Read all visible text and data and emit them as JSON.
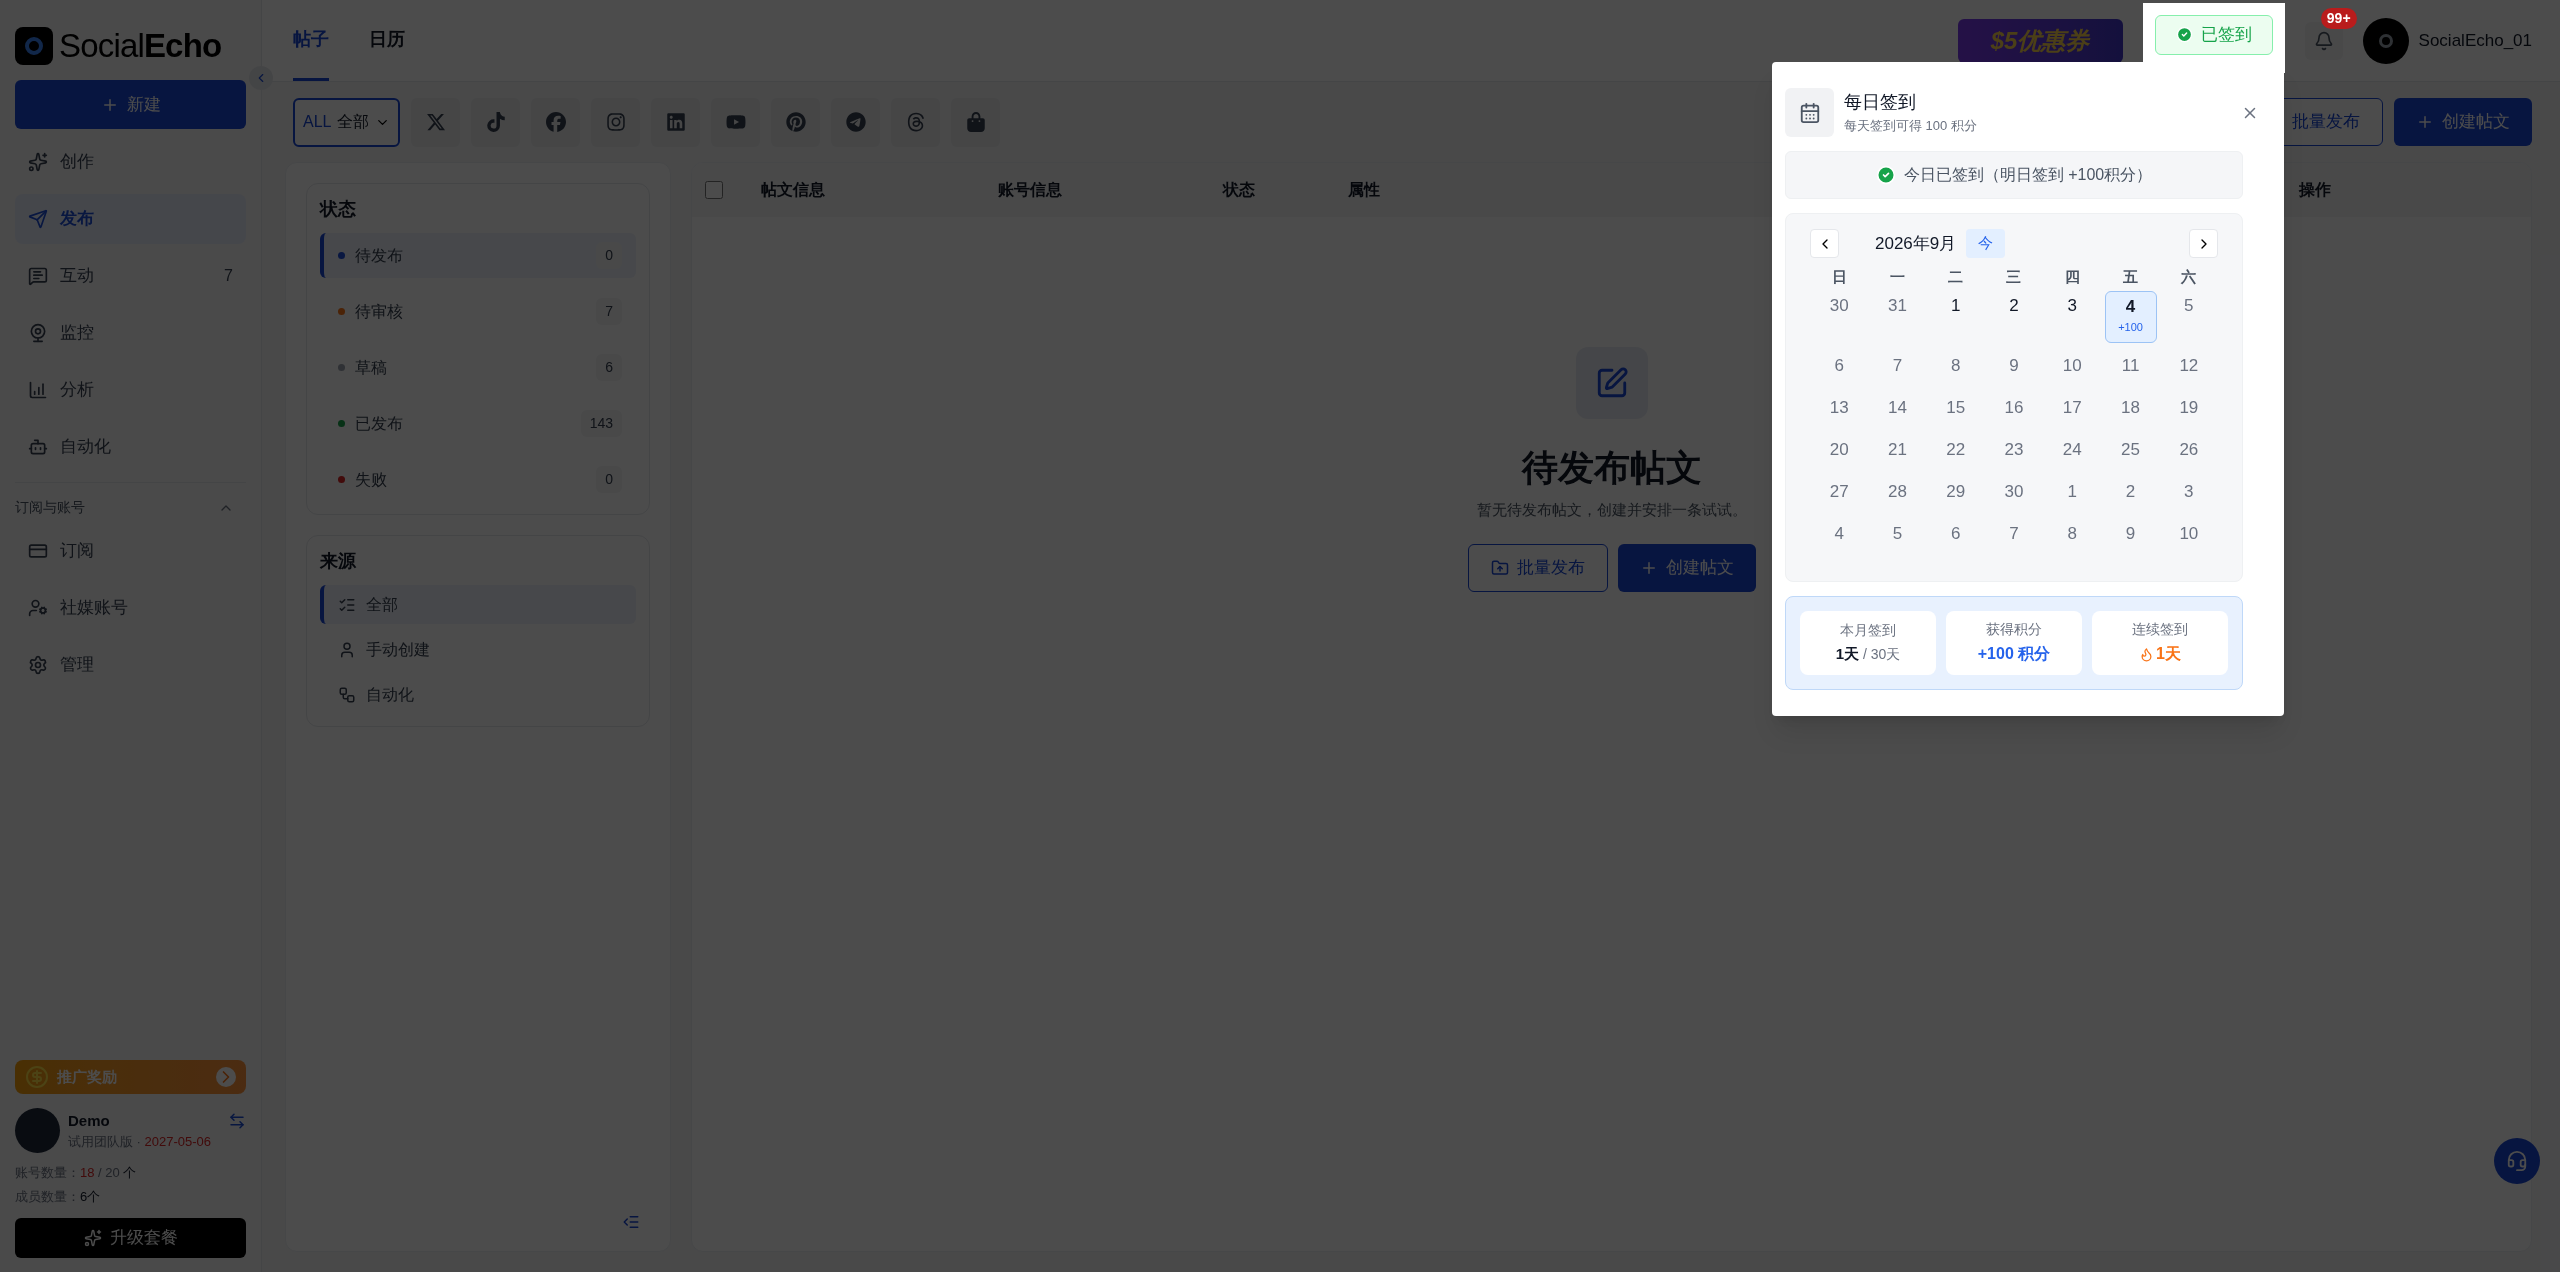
{
  "sidebar": {
    "logo": {
      "plain": "Social",
      "bold": "Echo"
    },
    "new_button": "新建",
    "nav": [
      {
        "label": "创作",
        "selected": false
      },
      {
        "label": "发布",
        "selected": true
      },
      {
        "label": "互动",
        "badge": "7",
        "selected": false
      },
      {
        "label": "监控",
        "selected": false
      },
      {
        "label": "分析",
        "selected": false
      },
      {
        "label": "自动化",
        "selected": false
      }
    ],
    "section": {
      "title": "订阅与账号",
      "expanded": true,
      "items": [
        {
          "label": "订阅",
          "selected": false
        },
        {
          "label": "社媒账号",
          "selected": false
        },
        {
          "label": "管理",
          "selected": false
        }
      ]
    },
    "promo": "推广奖励",
    "user": {
      "name": "Demo",
      "plan": "试用团队版 ·",
      "expiry": "2027-05-06"
    },
    "account_count": {
      "label": "账号数量：",
      "used": "18",
      "rest": "/ 20",
      "unit": "个"
    },
    "member_count": {
      "label": "成员数量：",
      "value": "6个"
    },
    "upgrade_button": "升级套餐"
  },
  "topbar": {
    "tabs": [
      {
        "label": "帖子",
        "selected": true
      },
      {
        "label": "日历",
        "selected": false
      }
    ],
    "coupon": "$5优惠券",
    "checkin_button": "已签到",
    "notification_badge": "99+",
    "username": "SocialEcho_01"
  },
  "filter": {
    "platform_select": {
      "prefix": "ALL",
      "value": "全部"
    }
  },
  "actions": [
    {
      "label": "批量发布",
      "kind": "outline"
    },
    {
      "label": "创建帖文",
      "kind": "primary"
    }
  ],
  "status_filter": {
    "title": "状态",
    "items": [
      {
        "label": "待发布",
        "count": "0",
        "color": "#091741",
        "selected": true
      },
      {
        "label": "待审核",
        "count": "7",
        "color": "#4b2307",
        "selected": false
      },
      {
        "label": "草稿",
        "count": "6",
        "color": "#2f3135",
        "selected": false
      },
      {
        "label": "已发布",
        "count": "143",
        "color": "#073116",
        "selected": false
      },
      {
        "label": "失败",
        "count": "0",
        "color": "#420b0b",
        "selected": false
      }
    ]
  },
  "source_filter": {
    "title": "来源",
    "items": [
      {
        "label": "全部",
        "selected": true
      },
      {
        "label": "手动创建",
        "selected": false
      },
      {
        "label": "自动化",
        "selected": false
      }
    ]
  },
  "table": {
    "all_checked": false,
    "columns": [
      "帖文信息",
      "账号信息",
      "状态",
      "属性",
      "操作"
    ]
  },
  "empty_state": {
    "title": "待发布帖文",
    "description": "暂无待发布帖文，创建并安排一条试试。",
    "buttons": [
      {
        "label": "批量发布",
        "kind": "outline"
      },
      {
        "label": "创建帖文",
        "kind": "primary"
      }
    ]
  },
  "checkin_popup": {
    "title": "每日签到",
    "subtitle": "每天签到可得 100 积分",
    "status": "今日已签到（明日签到 +100积分）",
    "month": "2026年9月",
    "today_button": "今",
    "weekdays": [
      "日",
      "一",
      "二",
      "三",
      "四",
      "五",
      "六"
    ],
    "days": [
      {
        "day": "30",
        "kind": "muted"
      },
      {
        "day": "31",
        "kind": "muted"
      },
      {
        "day": "1",
        "kind": "past"
      },
      {
        "day": "2",
        "kind": "past"
      },
      {
        "day": "3",
        "kind": "past"
      },
      {
        "day": "4",
        "kind": "today",
        "reward": "+100"
      },
      {
        "day": "5",
        "kind": "muted"
      },
      {
        "day": "6",
        "kind": "muted"
      },
      {
        "day": "7",
        "kind": "muted"
      },
      {
        "day": "8",
        "kind": "muted"
      },
      {
        "day": "9",
        "kind": "muted"
      },
      {
        "day": "10",
        "kind": "muted"
      },
      {
        "day": "11",
        "kind": "muted"
      },
      {
        "day": "12",
        "kind": "muted"
      },
      {
        "day": "13",
        "kind": "muted"
      },
      {
        "day": "14",
        "kind": "muted"
      },
      {
        "day": "15",
        "kind": "muted"
      },
      {
        "day": "16",
        "kind": "muted"
      },
      {
        "day": "17",
        "kind": "muted"
      },
      {
        "day": "18",
        "kind": "muted"
      },
      {
        "day": "19",
        "kind": "muted"
      },
      {
        "day": "20",
        "kind": "muted"
      },
      {
        "day": "21",
        "kind": "muted"
      },
      {
        "day": "22",
        "kind": "muted"
      },
      {
        "day": "23",
        "kind": "muted"
      },
      {
        "day": "24",
        "kind": "muted"
      },
      {
        "day": "25",
        "kind": "muted"
      },
      {
        "day": "26",
        "kind": "muted"
      },
      {
        "day": "27",
        "kind": "muted"
      },
      {
        "day": "28",
        "kind": "muted"
      },
      {
        "day": "29",
        "kind": "muted"
      },
      {
        "day": "30",
        "kind": "muted"
      },
      {
        "day": "1",
        "kind": "muted"
      },
      {
        "day": "2",
        "kind": "muted"
      },
      {
        "day": "3",
        "kind": "muted"
      },
      {
        "day": "4",
        "kind": "muted"
      },
      {
        "day": "5",
        "kind": "muted"
      },
      {
        "day": "6",
        "kind": "muted"
      },
      {
        "day": "7",
        "kind": "muted"
      },
      {
        "day": "8",
        "kind": "muted"
      },
      {
        "day": "9",
        "kind": "muted"
      },
      {
        "day": "10",
        "kind": "muted"
      }
    ],
    "stats": [
      {
        "label": "本月签到",
        "value": "1天",
        "suffix": "/ 30天",
        "kind": "days"
      },
      {
        "label": "获得积分",
        "value": "+100 积分",
        "kind": "points"
      },
      {
        "label": "连续签到",
        "value": "1天",
        "kind": "streak"
      }
    ]
  }
}
